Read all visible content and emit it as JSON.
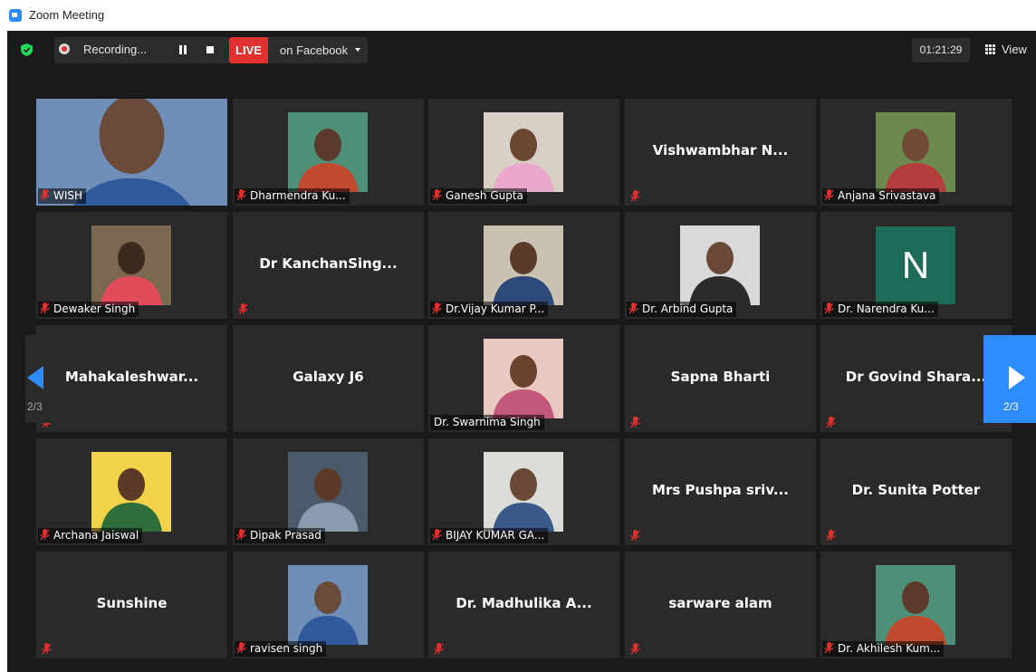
{
  "window": {
    "title": "Zoom Meeting"
  },
  "toolbar": {
    "recording_label": "Recording...",
    "live_label": "LIVE",
    "live_target": "on Facebook",
    "timer": "01:21:29",
    "view_label": "View"
  },
  "pagination": {
    "left_page": "2/3",
    "right_page": "2/3"
  },
  "participants": [
    {
      "label": "WISH",
      "center": "",
      "video": true,
      "muted": true
    },
    {
      "label": "Dharmendra Ku...",
      "center": "",
      "video": true,
      "muted": true
    },
    {
      "label": "Ganesh Gupta",
      "center": "",
      "video": true,
      "muted": true
    },
    {
      "label": "",
      "center": "Vishwambhar N...",
      "video": false,
      "muted": true
    },
    {
      "label": "Anjana Srivastava",
      "center": "",
      "video": true,
      "muted": true
    },
    {
      "label": "Dewaker Singh",
      "center": "",
      "video": true,
      "muted": true
    },
    {
      "label": "",
      "center": "Dr  KanchanSing...",
      "video": false,
      "muted": true
    },
    {
      "label": "Dr.Vijay Kumar P...",
      "center": "",
      "video": true,
      "muted": true
    },
    {
      "label": "Dr. Arbind Gupta",
      "center": "",
      "video": true,
      "muted": true
    },
    {
      "label": "Dr. Narendra Ku...",
      "center": "",
      "video": false,
      "muted": true,
      "avatar_letter": "N"
    },
    {
      "label": "",
      "center": "Mahakaleshwar...",
      "video": false,
      "muted": true
    },
    {
      "label": "",
      "center": "Galaxy J6",
      "video": false,
      "muted": false
    },
    {
      "label": "Dr. Swarnima Singh",
      "center": "",
      "video": true,
      "muted": false
    },
    {
      "label": "",
      "center": "Sapna Bharti",
      "video": false,
      "muted": true
    },
    {
      "label": "",
      "center": "Dr Govind Shara...",
      "video": false,
      "muted": true
    },
    {
      "label": "Archana Jaiswal",
      "center": "",
      "video": true,
      "muted": true
    },
    {
      "label": "Dipak Prasad",
      "center": "",
      "video": true,
      "muted": true
    },
    {
      "label": "BIJAY KUMAR GA...",
      "center": "",
      "video": true,
      "muted": true
    },
    {
      "label": "",
      "center": "Mrs  Pushpa sriv...",
      "video": false,
      "muted": true
    },
    {
      "label": "",
      "center": "Dr. Sunita Potter",
      "video": false,
      "muted": true
    },
    {
      "label": "",
      "center": "Sunshine",
      "video": false,
      "muted": true
    },
    {
      "label": "ravisen singh",
      "center": "",
      "video": true,
      "muted": true
    },
    {
      "label": "",
      "center": "Dr. Madhulika A...",
      "video": false,
      "muted": true
    },
    {
      "label": "",
      "center": "sarware alam",
      "video": false,
      "muted": true
    },
    {
      "label": "Dr. Akhilesh Kum...",
      "center": "",
      "video": true,
      "muted": true
    }
  ],
  "colors": {
    "live": "#e0312f",
    "accent": "#2d8cff",
    "tile": "#2a2a2a",
    "background": "#1a1a1a",
    "avatar_n": "#1d6b58"
  }
}
